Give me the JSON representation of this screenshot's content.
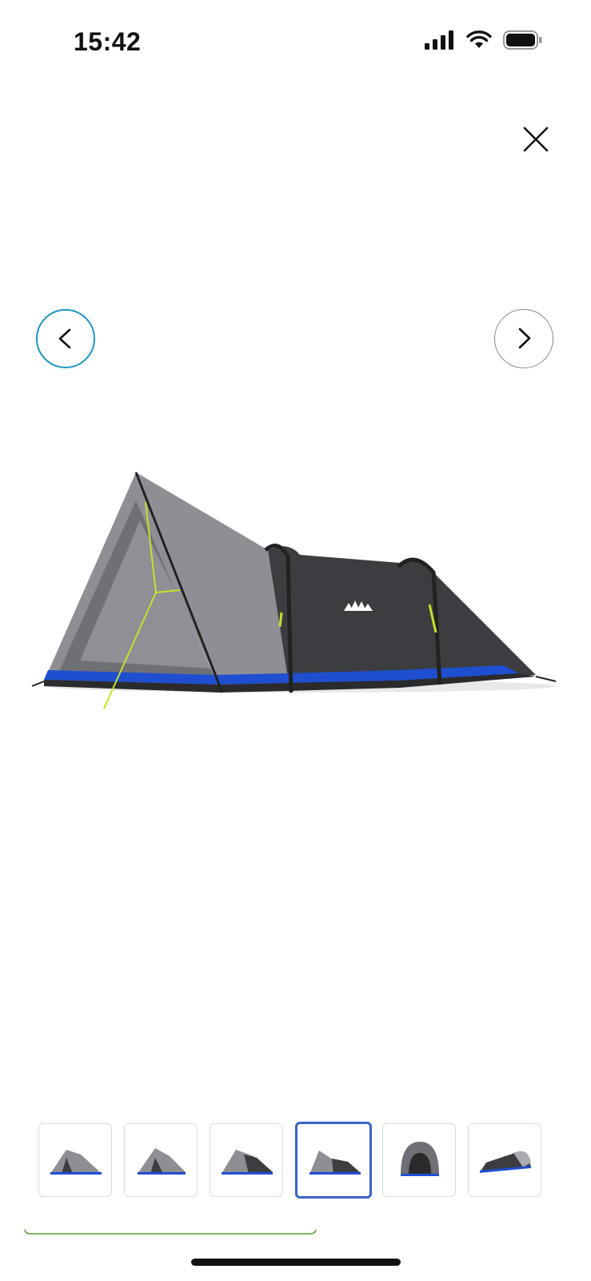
{
  "status_bar": {
    "time": "15:42",
    "icons": [
      "cellular-signal-icon",
      "wifi-icon",
      "battery-icon"
    ]
  },
  "controls": {
    "close_icon": "close-icon",
    "prev_icon": "chevron-left-icon",
    "next_icon": "chevron-right-icon"
  },
  "gallery": {
    "thumbnail_count": 6,
    "active_index": 3,
    "views": [
      "tent-angled",
      "tent-angled",
      "tent-angled",
      "tent-side",
      "tent-front",
      "tent-rear-angled"
    ]
  },
  "colors": {
    "prev_ring": "#1f95c4",
    "next_ring": "#888888",
    "active_thumb_border": "#3d63c7",
    "thumb_border": "#d5dce8",
    "progress_line": "#5aa02c",
    "tent_grey": "#8e8f94",
    "tent_dark": "#3b3d40",
    "tent_blue": "#1f4fd0",
    "guy_line": "#c6e02a"
  }
}
